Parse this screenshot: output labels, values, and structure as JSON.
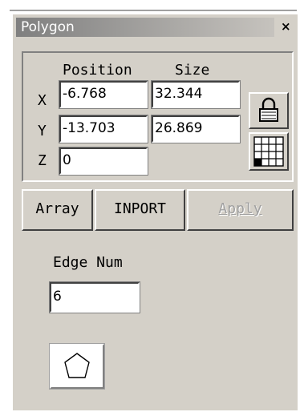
{
  "title": "Polygon",
  "close_glyph": "×",
  "labels": {
    "position": "Position",
    "size": "Size",
    "x": "X",
    "y": "Y",
    "z": "Z",
    "edge_num": "Edge Num"
  },
  "position": {
    "x": "-6.768",
    "y": "-13.703",
    "z": "0"
  },
  "size": {
    "x": "32.344",
    "y": "26.869"
  },
  "buttons": {
    "array": "Array",
    "import": "INPORT",
    "apply": "Apply"
  },
  "edge_num": "6",
  "icons": {
    "lock": "lock-icon",
    "grid": "grid-anchor-icon",
    "shape": "pentagon-icon"
  }
}
